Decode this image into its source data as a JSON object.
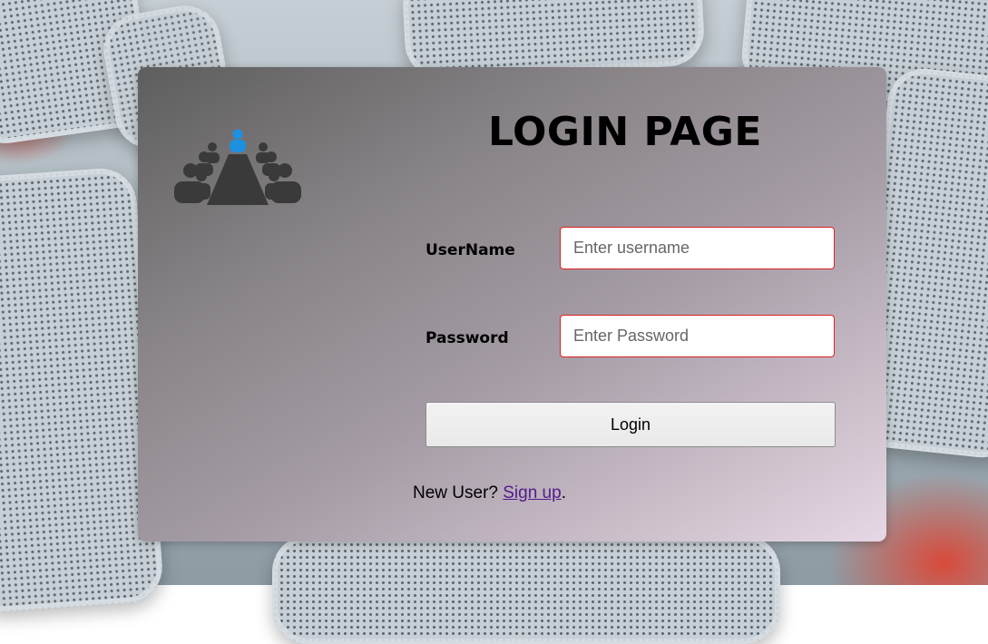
{
  "page": {
    "title": "LOGIN PAGE"
  },
  "logo": {
    "icon": "meeting-table-icon",
    "accent_color": "#1e90e0",
    "figure_color": "#3a3a3a"
  },
  "form": {
    "username_label": "UserName",
    "username_placeholder": "Enter username",
    "username_value": "",
    "password_label": "Password",
    "password_placeholder": "Enter Password",
    "password_value": "",
    "login_label": "Login",
    "field_border_color": "#e02020"
  },
  "footer": {
    "prompt": "New User? ",
    "link_text": "Sign up",
    "suffix": "."
  }
}
